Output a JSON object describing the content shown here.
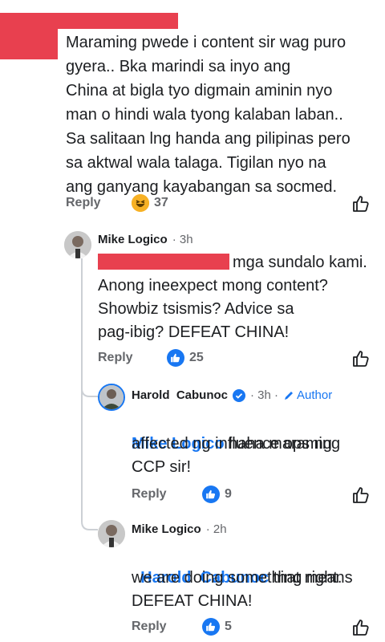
{
  "colors": {
    "accent": "#1877f2",
    "redaction": "#e8404f",
    "muted": "#65676b",
    "thread": "#ccd0d5"
  },
  "top_comment": {
    "text": "Maraming pwede i content sir wag puro\ngyera.. Bka marindi sa inyo ang\nChina at bigla tyo digmain aminin nyo\nman o hindi wala tyong kalaban laban..\nSa salitaan lng handa ang pilipinas pero\nsa aktwal wala talaga. Tigilan nyo na\nang ganyang kayabangan sa socmed.",
    "reply_label": "Reply",
    "reaction_icon": "haha-emoji-icon",
    "reaction_count": "37"
  },
  "reply1": {
    "name": "Mike Logico",
    "time": "· 3h",
    "text_first": "mga sundalo kami.",
    "text_rest": "Anong ineexpect mong content?\nShowbiz tsismis? Advice sa\npag-ibig? DEFEAT CHINA!",
    "reply_label": "Reply",
    "reaction_icon": "like-icon",
    "reaction_count": "25"
  },
  "reply2": {
    "name": "Harold  Cabunoc",
    "verified_icon": "verified-badge-icon",
    "time": "· 3h ·",
    "author_label": "Author",
    "mention": "Mike Logico",
    "text_first": " haha maraming",
    "text_rest": "affected ng influence ops ng\nCCP sir!",
    "reply_label": "Reply",
    "reaction_icon": "like-icon",
    "reaction_count": "9"
  },
  "reply3": {
    "name": "Mike Logico",
    "time": "· 2h",
    "mention": "Harold  Cabunoc",
    "text_first": " that means",
    "text_rest": "we are doing something right.\nDEFEAT CHINA!",
    "reply_label": "Reply",
    "reaction_icon": "like-icon",
    "reaction_count": "5"
  }
}
